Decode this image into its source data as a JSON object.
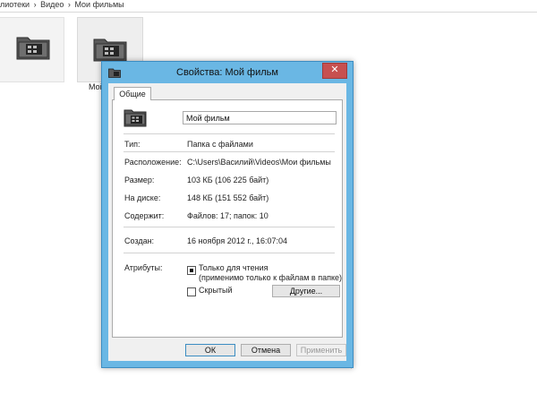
{
  "explorer": {
    "breadcrumb": [
      "лиотеки",
      "›",
      "Видео",
      "›",
      "Мои фильмы"
    ],
    "folder_label": "Мой"
  },
  "dialog": {
    "title": "Свойства: Мой фильм",
    "close_glyph": "✕",
    "tab_general": "Общие",
    "folder_name": "Мой фильм",
    "fields": {
      "type_label": "Тип:",
      "type_value": "Папка с файлами",
      "location_label": "Расположение:",
      "location_value": "C:\\Users\\Василий\\Videos\\Мои фильмы",
      "size_label": "Размер:",
      "size_value": "103 КБ (106 225 байт)",
      "disk_label": "На диске:",
      "disk_value": "148 КБ (151 552 байт)",
      "contains_label": "Содержит:",
      "contains_value": "Файлов: 17; папок: 10",
      "created_label": "Создан:",
      "created_value": "16 ноября 2012 г., 16:07:04",
      "attributes_label": "Атрибуты:"
    },
    "readonly_label": "Только для чтения",
    "readonly_note": "(применимо только к файлам в папке)",
    "readonly_checked": true,
    "hidden_label": "Скрытый",
    "hidden_checked": false,
    "other_button": "Другие...",
    "ok_button": "ОК",
    "cancel_button": "Отмена",
    "apply_button": "Применить"
  },
  "colors": {
    "frame": "#6ab7e4",
    "close": "#c75050",
    "client": "#f0f0f0"
  }
}
